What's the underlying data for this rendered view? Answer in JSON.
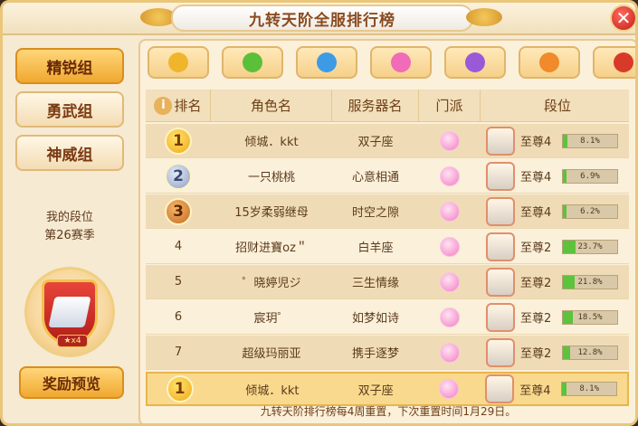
{
  "title": "九转天阶全服排行榜",
  "close_label": "✕",
  "groups": [
    {
      "label": "精锐组",
      "active": true
    },
    {
      "label": "勇武组",
      "active": false
    },
    {
      "label": "神威组",
      "active": false
    }
  ],
  "my_rank": {
    "label": "我的段位",
    "season": "第26赛季",
    "stars": "★x4"
  },
  "reward_button": "奖励预览",
  "factions": [
    {
      "icon": "gold-swirl-icon",
      "color": "#f0b52a"
    },
    {
      "icon": "green-leaf-icon",
      "color": "#5bbf3a"
    },
    {
      "icon": "blue-wave-icon",
      "color": "#3d9be6"
    },
    {
      "icon": "pink-lotus-icon",
      "color": "#f06bb8"
    },
    {
      "icon": "purple-skull-icon",
      "color": "#9a5ad8"
    },
    {
      "icon": "orange-flame-icon",
      "color": "#f08a2a"
    },
    {
      "icon": "red-beast-icon",
      "color": "#d83a2a"
    }
  ],
  "table": {
    "headers": [
      "排名",
      "角色名",
      "服务器名",
      "门派",
      "段位"
    ],
    "rows": [
      {
        "rank": "1",
        "medal": "gold",
        "name": "倾城．kkt",
        "server": "双子座",
        "tier": "至尊4",
        "progress": "8.1%",
        "fill": 0.081
      },
      {
        "rank": "2",
        "medal": "silver",
        "name": "一只桃桃",
        "server": "心意相通",
        "tier": "至尊4",
        "progress": "6.9%",
        "fill": 0.069
      },
      {
        "rank": "3",
        "medal": "bronze",
        "name": "15岁柔弱继母",
        "server": "时空之隙",
        "tier": "至尊4",
        "progress": "6.2%",
        "fill": 0.062
      },
      {
        "rank": "4",
        "medal": "",
        "name": "招财进寶oz＂",
        "server": "白羊座",
        "tier": "至尊2",
        "progress": "23.7%",
        "fill": 0.237
      },
      {
        "rank": "5",
        "medal": "",
        "name": "゜晓婷児ジ",
        "server": "三生情缘",
        "tier": "至尊2",
        "progress": "21.8%",
        "fill": 0.218
      },
      {
        "rank": "6",
        "medal": "",
        "name": "宸玥゜",
        "server": "如梦如诗",
        "tier": "至尊2",
        "progress": "18.5%",
        "fill": 0.185
      },
      {
        "rank": "7",
        "medal": "",
        "name": "超级玛丽亚",
        "server": "携手逐梦",
        "tier": "至尊2",
        "progress": "12.8%",
        "fill": 0.128
      }
    ],
    "self_row": {
      "rank": "1",
      "medal": "gold",
      "name": "倾城．kkt",
      "server": "双子座",
      "tier": "至尊4",
      "progress": "8.1%",
      "fill": 0.081
    }
  },
  "footer": "九转天阶排行榜每4周重置，下次重置时间1月29日。"
}
